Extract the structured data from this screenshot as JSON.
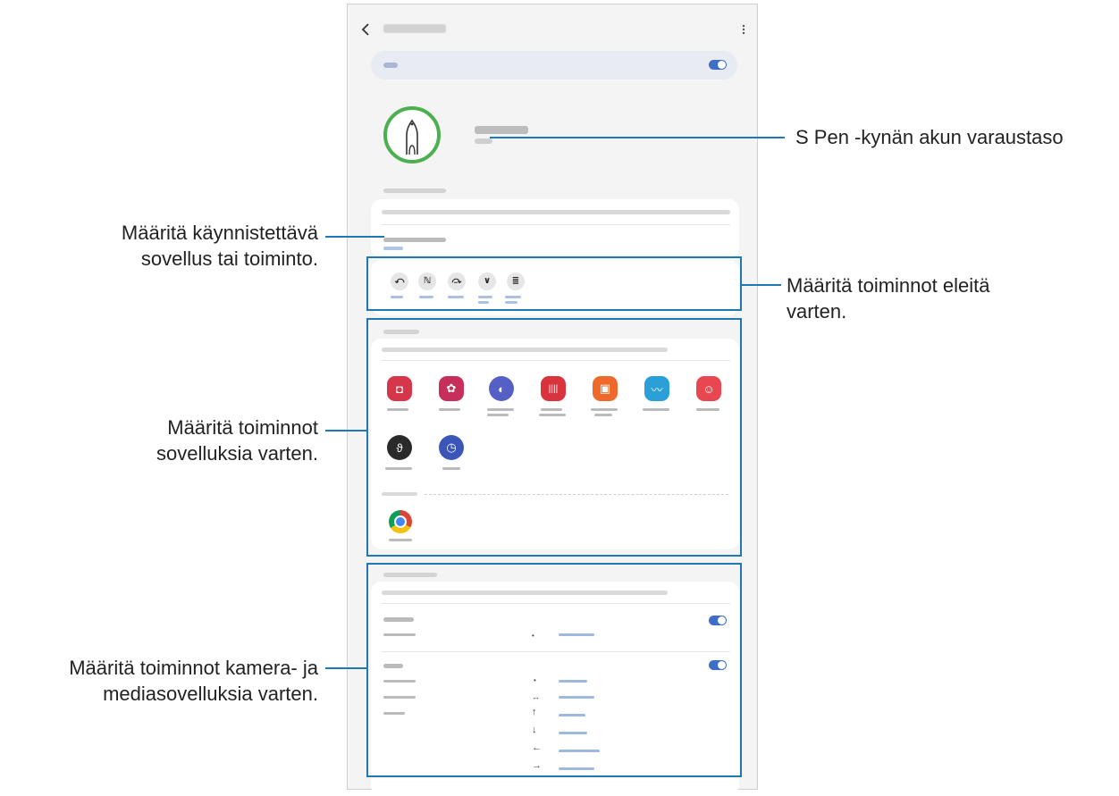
{
  "callouts": {
    "battery": "S Pen -kynän akun varaustaso",
    "launch_line1": "Määritä käynnistettävä",
    "launch_line2": "sovellus tai toiminto.",
    "gestures_line1": "Määritä toiminnot eleitä",
    "gestures_line2": "varten.",
    "apps_line1": "Määritä toiminnot",
    "apps_line2": "sovelluksia varten.",
    "media_line1": "Määritä toiminnot kamera- ja",
    "media_line2": "mediasovelluksia varten."
  },
  "icons": {
    "back": "chevron-left-icon",
    "more": "more-vertical-icon",
    "pen": "s-pen-icon",
    "gestures": [
      "swipe-left-gesture-icon",
      "cursive-gesture-icon",
      "swipe-right-gesture-icon",
      "up-down-gesture-icon",
      "circle-gesture-icon"
    ],
    "apps": [
      "camera-icon",
      "gallery-icon",
      "internet-icon",
      "voice-recorder-icon",
      "samsung-notes-icon",
      "penup-icon",
      "ar-emoji-icon",
      "lasso-app-icon",
      "clock-icon",
      "chrome-icon"
    ],
    "arrows": [
      "dot-icon",
      "swap-icon",
      "arrow-up-icon",
      "arrow-down-icon",
      "arrow-left-icon",
      "arrow-right-icon"
    ]
  },
  "colors": {
    "frame": "#1f77b4",
    "toggle": "#3d6fc9",
    "battery_ring": "#4caf50",
    "camera": "#d6364a",
    "gallery": "#c62f5a",
    "internet": "#5460c6",
    "recorder": "#d9343d",
    "notes": "#ee6a2a",
    "penup": "#2ba0d8",
    "emoji": "#e8474f"
  }
}
